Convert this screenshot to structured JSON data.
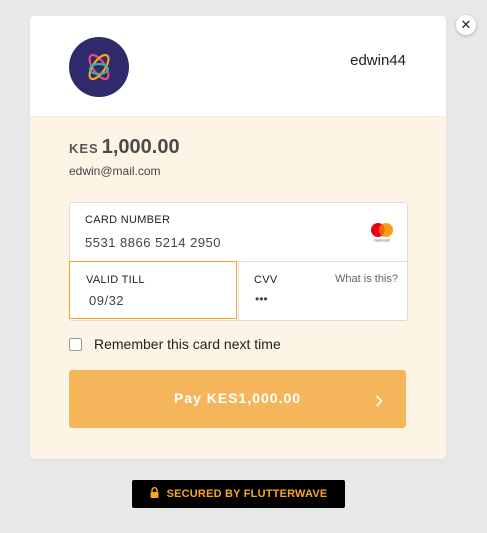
{
  "header": {
    "username": "edwin44",
    "logo_icon": "flutterwave-logo-icon"
  },
  "payment": {
    "currency": "KES",
    "amount": "1,000.00",
    "email": "edwin@mail.com"
  },
  "card_form": {
    "card_number_label": "CARD NUMBER",
    "card_number_value": "5531 8866 5214 2950",
    "card_brand": "mastercard",
    "card_brand_text": "mastercard",
    "valid_till_label": "VALID TILL",
    "valid_till_value": "09/32",
    "cvv_label": "CVV",
    "cvv_value": "•••",
    "cvv_help_link": "What is this?"
  },
  "remember": {
    "label": "Remember this card next time",
    "checked": false
  },
  "pay_button": {
    "label": "Pay KES1,000.00"
  },
  "footer": {
    "secured_label": "SECURED BY FLUTTERWAVE",
    "lock_icon": "lock-icon"
  },
  "colors": {
    "accent": "#f5a623",
    "button": "#f5b65b",
    "panel": "#fef4e6",
    "logo_bg": "#2f2a6b"
  }
}
